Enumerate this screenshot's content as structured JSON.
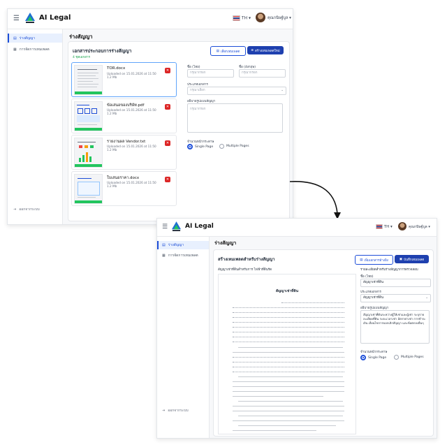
{
  "app": {
    "brand": "AI Legal",
    "logo_text": "AXONS",
    "lang": "TH",
    "user": "คุณกนิษฐ์บูล"
  },
  "sidebar": {
    "items": [
      {
        "label": "ร่างสัญญา",
        "icon": "document-icon",
        "active": true
      },
      {
        "label": "การจัดการเทมเพลต",
        "icon": "template-icon",
        "active": false
      }
    ],
    "logout": "ออกจากระบบ"
  },
  "screen1": {
    "page_title": "ร่างสัญญา",
    "section_title": "เอกสารประกอบการร่างสัญญา",
    "section_sub": "4 ชุดเอกสาร",
    "btn_template": "เลือกเทมเพลต",
    "btn_create": "สร้างเทมเพลตใหม่",
    "files": [
      {
        "name": "TOR.docx",
        "uploaded": "Uploaded on 15.01.2026 at 11:50",
        "size": "1.2 Mb"
      },
      {
        "name": "ข้อเสนอของบริษัท.pdf",
        "uploaded": "Uploaded on 15.01.2026 at 11:50",
        "size": "1.2 Mb"
      },
      {
        "name": "รายงานผล Vendor.txt",
        "uploaded": "Uploaded on 15.01.2026 at 11:50",
        "size": "1.2 Mb"
      },
      {
        "name": "ใบเสนอราคา.docx",
        "uploaded": "Uploaded on 15.01.2026 at 11:50",
        "size": "1.2 Mb"
      }
    ],
    "form": {
      "name_th_label": "ชื่อ (ไทย)",
      "name_th_ph": "กรุณากรอก",
      "name_en_label": "ชื่อ (อังกฤษ)",
      "name_en_ph": "กรุณากรอก",
      "type_label": "ประเภทเอกสาร",
      "type_ph": "กรุณาเลือก",
      "desc_label": "อธิบายรูปแบบสัญญา",
      "desc_ph": "กรุณากรอก",
      "pages_label": "จำนวนหน้ากระดาษ",
      "single": "Single Page",
      "multi": "Multiple Pages"
    }
  },
  "screen2": {
    "page_title": "ร่างสัญญา",
    "section_title": "สร้างเทมเพลตสำหรับร่างสัญญา",
    "doc_heading": "สัญญาเช่าที่ดินสำหรับการ ไฟฟ้าที่ดินรัด",
    "btn_add": "เพิ่มเอกสารอ้างอิง",
    "btn_save": "บันทึกเทมเพลต",
    "doc_title": "สัญญาเช่าที่ดิน",
    "form": {
      "header": "รายละเอียดสำหรับร่างสัญญาการตรวจสอบ",
      "name_label": "ชื่อ (ไทย)",
      "name_value": "สัญญาเช่าที่ดิน",
      "type_label": "ประเภทเอกสาร",
      "type_value": "สัญญาเช่าที่ดิน",
      "desc_label": "อธิบายรูปแบบสัญญา",
      "desc_value": "สัญญาเช่าที่ดินระหว่างผู้ให้เช่าและผู้เช่า ระบุรายละเอียดที่ดิน ระยะเวลาเช่า อัตราค่าเช่า การชำระเงิน เงื่อนไขการบอกเลิกสัญญา และข้อตกลงอื่นๆ",
      "pages_label": "จำนวนหน้ากระดาษ",
      "single": "Single Page",
      "multi": "Multiple Pages"
    }
  }
}
